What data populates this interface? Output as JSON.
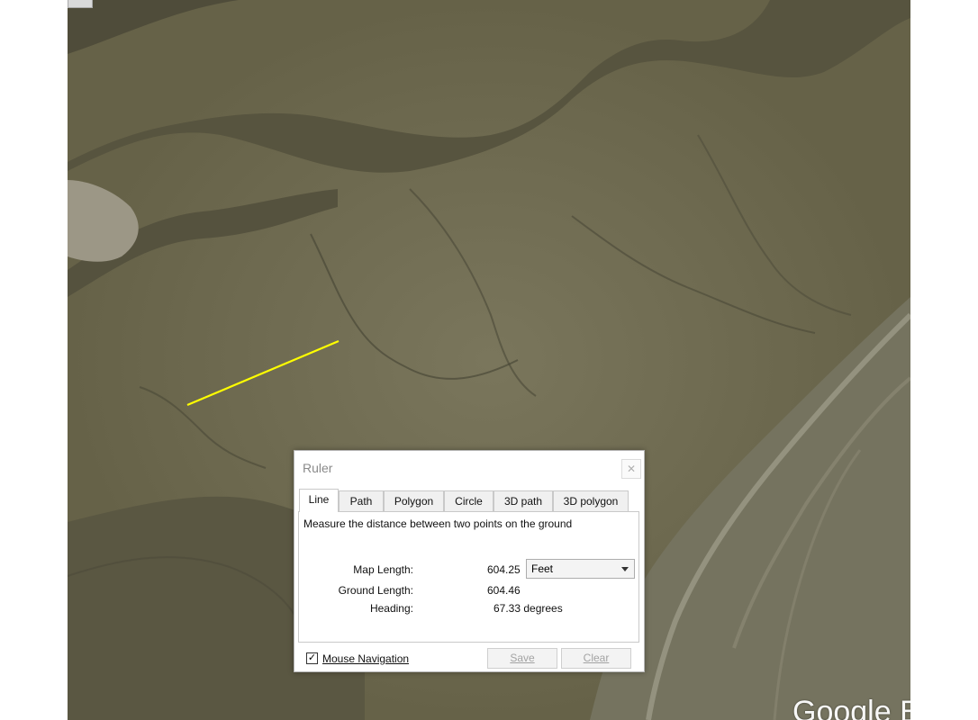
{
  "map": {
    "watermark": "Google E",
    "colors": {
      "terrain": "#6e6a52",
      "measure_line": "#ffff00"
    }
  },
  "ruler": {
    "title": "Ruler",
    "close_icon": "close-icon",
    "tabs": [
      {
        "label": "Line",
        "active": true
      },
      {
        "label": "Path",
        "active": false
      },
      {
        "label": "Polygon",
        "active": false
      },
      {
        "label": "Circle",
        "active": false
      },
      {
        "label": "3D path",
        "active": false
      },
      {
        "label": "3D polygon",
        "active": false
      }
    ],
    "description": "Measure the distance between two points on the ground",
    "map_length_label": "Map Length:",
    "map_length_value": "604.25",
    "unit_selected": "Feet",
    "ground_length_label": "Ground Length:",
    "ground_length_value": "604.46",
    "heading_label": "Heading:",
    "heading_value": "67.33 degrees",
    "mouse_nav_label": "Mouse Navigation",
    "mouse_nav_checked": true,
    "checkmark": "✓",
    "save_label": "Save",
    "clear_label": "Clear"
  }
}
